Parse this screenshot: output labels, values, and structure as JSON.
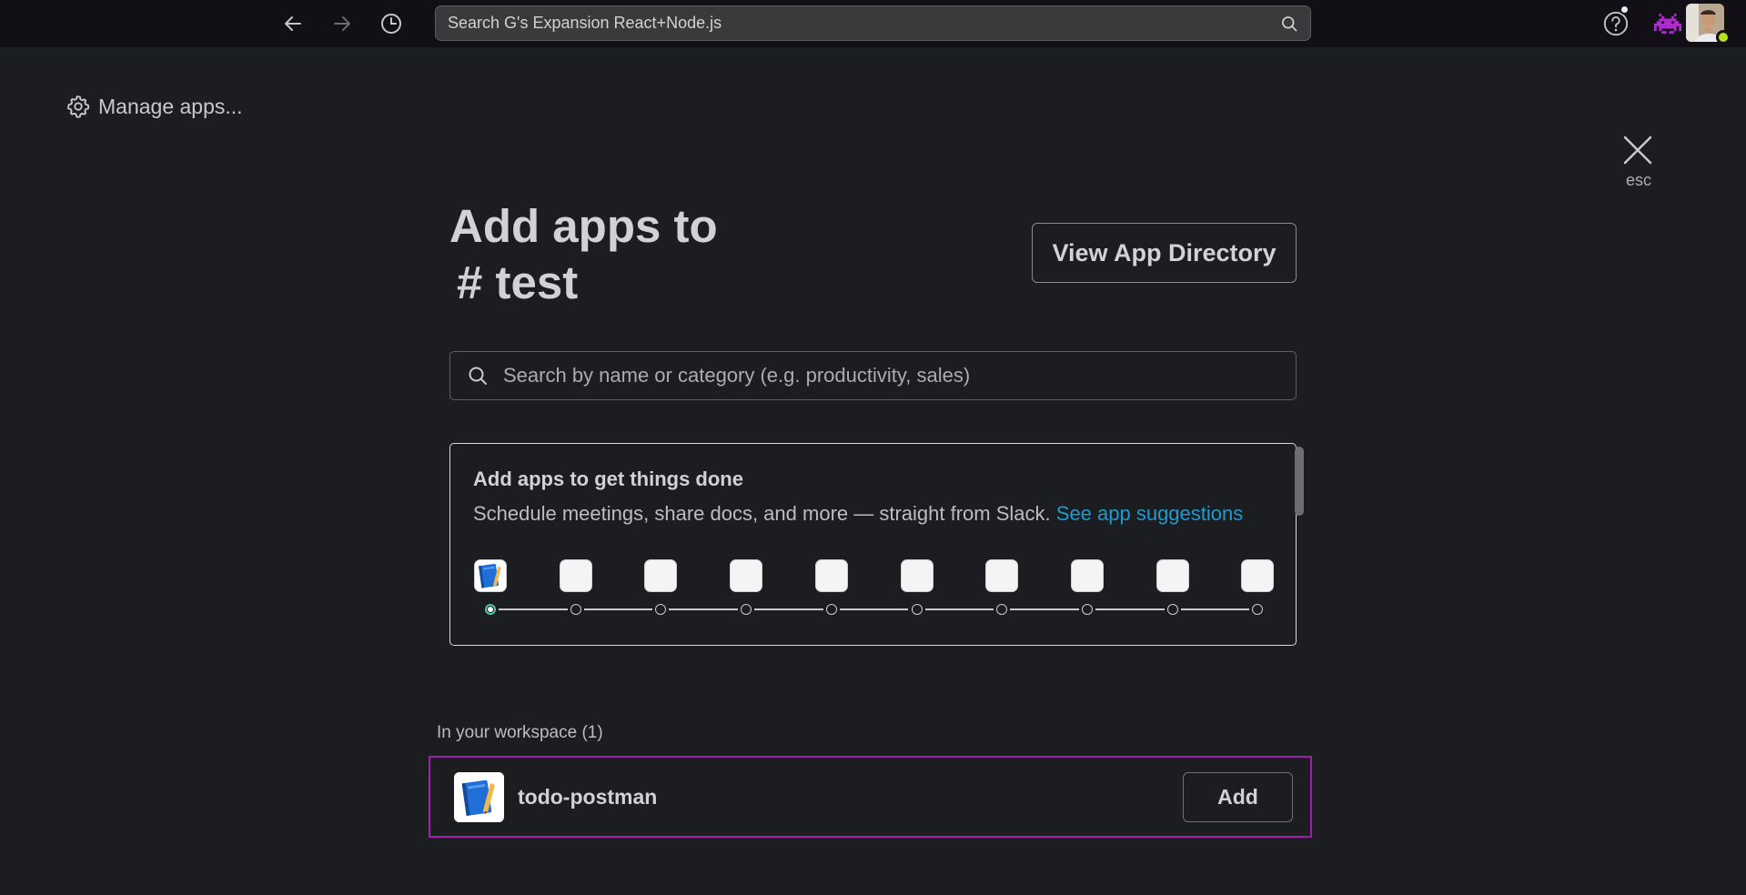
{
  "topbar": {
    "search_placeholder": "Search G's Expansion React+Node.js"
  },
  "sidebar": {
    "manage_apps_label": "Manage apps..."
  },
  "modal": {
    "close_hint": "esc",
    "title_line1": "Add apps to",
    "title_line2": "# test",
    "view_directory_label": "View App Directory",
    "search_placeholder": "Search by name or category (e.g. productivity, sales)",
    "suggestions": {
      "title": "Add apps to get things done",
      "description": "Schedule meetings, share docs, and more — straight from Slack.",
      "link_label": "See app suggestions",
      "tile_count": 10,
      "active_index": 0
    },
    "workspace": {
      "label": "In your workspace (1)",
      "apps": [
        {
          "name": "todo-postman",
          "add_label": "Add"
        }
      ]
    }
  },
  "colors": {
    "background": "#1b1d21",
    "topbar": "#121016",
    "link": "#1d9bd1",
    "highlight_border": "#a11fb0",
    "presence": "#b5e21f",
    "active_dot": "#4ec9a3"
  }
}
